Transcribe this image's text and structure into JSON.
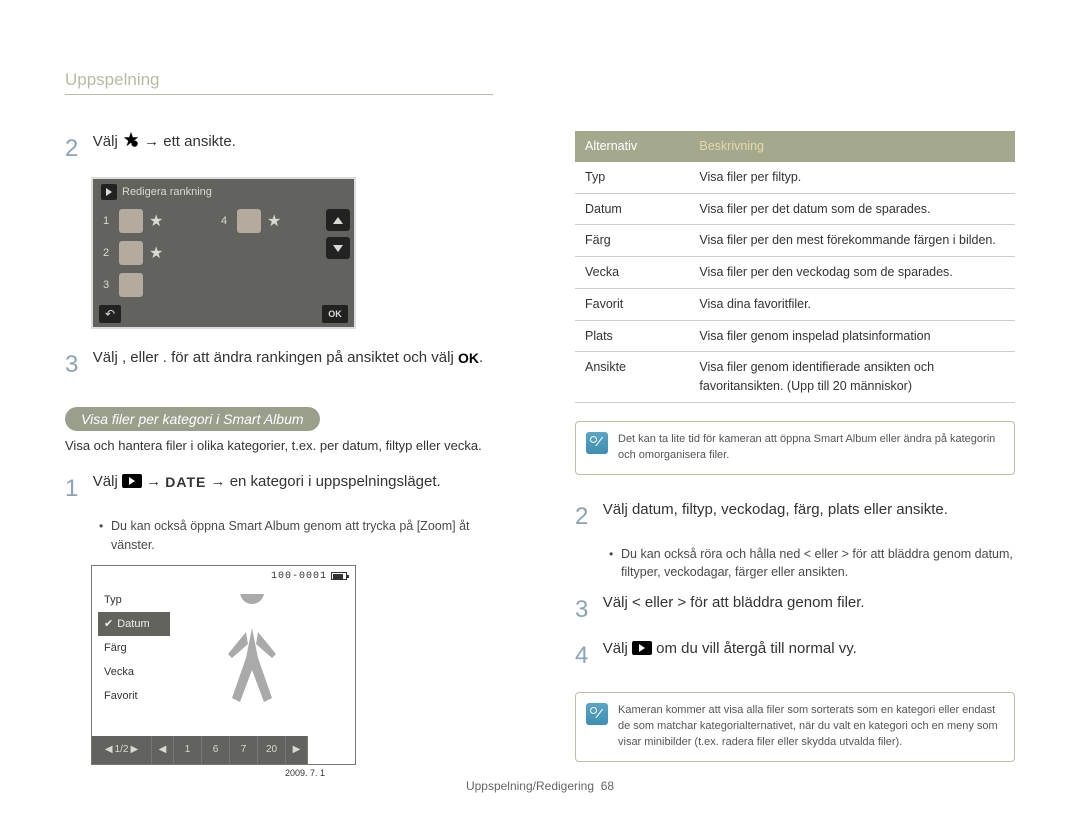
{
  "header": {
    "title": "Uppspelning"
  },
  "left": {
    "step2": {
      "prefix": "Välj ",
      "suffix": " → ett ansikte."
    },
    "ranking": {
      "title": "Redigera rankning",
      "rows": [
        "1",
        "2",
        "3",
        "4"
      ],
      "ok": "OK"
    },
    "step3": "Välj ,  eller .   för att ändra rankingen på ansiktet och välj ",
    "pill": "Visa filer per kategori i Smart Album",
    "pill_desc": "Visa och hantera ﬁler i olika kategorier, t.ex. per datum, ﬁltyp eller vecka.",
    "step1": {
      "prefix": "Välj ",
      "mid": " → ",
      "suffix": " → en kategori i uppspelningsläget."
    },
    "step1_bullet": "Du kan också öppna Smart Album genom att trycka på [Zoom] åt vänster.",
    "album": {
      "counter": "100-0001",
      "menu": [
        "Typ",
        "Datum",
        "Färg",
        "Vecka",
        "Favorit"
      ],
      "selected_index": 1,
      "page": "1/2",
      "thumbs": [
        "1",
        "6",
        "7",
        "20"
      ],
      "date": "2009. 7. 1"
    }
  },
  "right": {
    "table": {
      "head": [
        "Alternativ",
        "Beskrivning"
      ],
      "rows": [
        [
          "Typ",
          "Visa ﬁler per ﬁltyp."
        ],
        [
          "Datum",
          "Visa ﬁler per det datum som de sparades."
        ],
        [
          "Färg",
          "Visa ﬁler per den mest förekommande färgen i bilden."
        ],
        [
          "Vecka",
          "Visa ﬁler per den veckodag som de sparades."
        ],
        [
          "Favorit",
          "Visa dina favoritﬁler."
        ],
        [
          "Plats",
          "Visa ﬁler genom inspelad platsinformation"
        ],
        [
          "Ansikte",
          "Visa ﬁler genom identiﬁerade ansikten och favoritansikten. (Upp till 20 människor)"
        ]
      ]
    },
    "note1": "Det kan ta lite tid för kameran att öppna Smart Album eller ändra på kategorin och omorganisera ﬁler.",
    "step2": "Välj datum, filtyp, veckodag, färg, plats eller ansikte.",
    "step2_bullet": "Du kan också röra och hålla ned < eller > för att bläddra genom datum, ﬁltyper, veckodagar, färger eller ansikten.",
    "step3": "Välj < eller > för att bläddra genom filer.",
    "step4": {
      "prefix": "Välj ",
      "suffix": " om du vill återgå till normal vy."
    },
    "note2": "Kameran kommer att visa alla ﬁler som sorterats som en kategori eller endast de som matchar kategorialternativet, när du valt en kategori och en meny som visar minibilder (t.ex. radera ﬁler eller skydda utvalda ﬁler)."
  },
  "footer": {
    "text": "Uppspelning/Redigering",
    "page": "68"
  }
}
